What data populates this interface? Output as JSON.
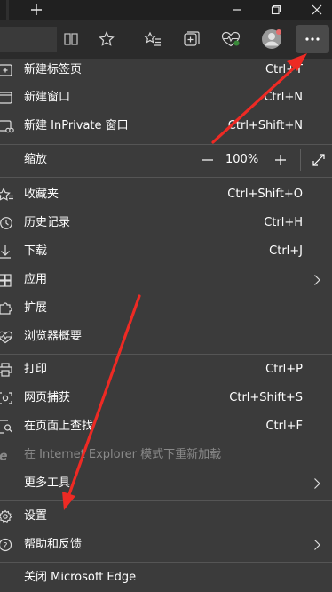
{
  "titlebar": {
    "new_tab_icon": "plus-icon",
    "minimize_icon": "minimize-icon",
    "restore_icon": "restore-icon",
    "close_icon": "close-icon"
  },
  "toolbar": {
    "icons": [
      "reading-view-icon",
      "favorite-star-icon",
      "favorites-list-icon",
      "collections-icon",
      "browser-essentials-icon",
      "profile-avatar",
      "more-icon"
    ]
  },
  "menu": {
    "new_tab": {
      "label": "新建标签页",
      "shortcut": "Ctrl+T"
    },
    "new_window": {
      "label": "新建窗口",
      "shortcut": "Ctrl+N"
    },
    "new_inprivate": {
      "label": "新建 InPrivate 窗口",
      "shortcut": "Ctrl+Shift+N"
    },
    "zoom": {
      "label": "缩放",
      "value": "100%",
      "minus": "—",
      "plus": "+"
    },
    "favorites": {
      "label": "收藏夹",
      "shortcut": "Ctrl+Shift+O"
    },
    "history": {
      "label": "历史记录",
      "shortcut": "Ctrl+H"
    },
    "downloads": {
      "label": "下载",
      "shortcut": "Ctrl+J"
    },
    "apps": {
      "label": "应用"
    },
    "extensions": {
      "label": "扩展"
    },
    "essentials": {
      "label": "浏览器概要"
    },
    "print": {
      "label": "打印",
      "shortcut": "Ctrl+P"
    },
    "web_capture": {
      "label": "网页捕获",
      "shortcut": "Ctrl+Shift+S"
    },
    "find": {
      "label": "在页面上查找",
      "shortcut": "Ctrl+F"
    },
    "ie_mode": {
      "label": "在 Internet Explorer 模式下重新加载"
    },
    "more_tools": {
      "label": "更多工具"
    },
    "settings": {
      "label": "设置"
    },
    "help": {
      "label": "帮助和反馈"
    },
    "close_edge": {
      "label": "关闭 Microsoft Edge"
    }
  },
  "colors": {
    "menu_bg": "#3b3b3b",
    "toolbar_bg": "#2b2b2b",
    "titlebar_bg": "#202020",
    "annotation_red": "#ee2a24",
    "disabled_text": "#8a8a8a"
  }
}
